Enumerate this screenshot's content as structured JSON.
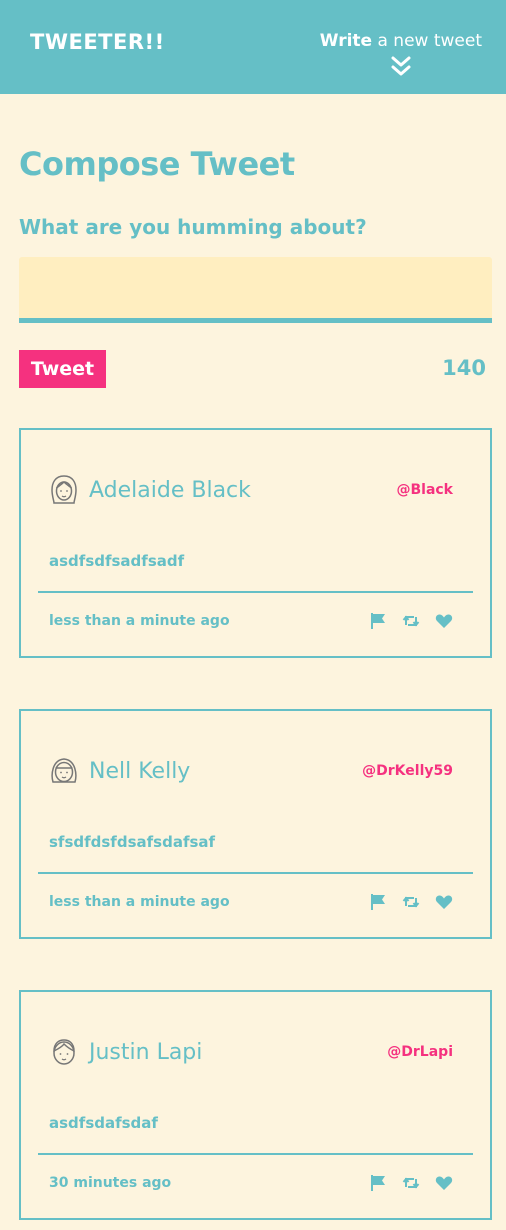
{
  "header": {
    "brand": "TWEETER!!",
    "write_bold": "Write",
    "write_rest": "a new tweet"
  },
  "compose": {
    "title": "Compose Tweet",
    "prompt": "What are you humming about?",
    "input_value": "",
    "button_label": "Tweet",
    "counter": "140"
  },
  "tweets": [
    {
      "name": "Adelaide Black",
      "handle": "@Black",
      "content": "asdfsdfsadfsadf",
      "time": "less than a minute ago",
      "avatar_icon": "woman-avatar-icon"
    },
    {
      "name": "Nell Kelly",
      "handle": "@DrKelly59",
      "content": "sfsdfdsfdsafsdafsaf",
      "time": "less than a minute ago",
      "avatar_icon": "girl-avatar-icon"
    },
    {
      "name": "Justin Lapi",
      "handle": "@DrLapi",
      "content": "asdfsdafsdaf",
      "time": "30 minutes ago",
      "avatar_icon": "man-avatar-icon"
    }
  ],
  "colors": {
    "background": "#fdf4de",
    "accent": "#65bfc6",
    "pink": "#f5317f",
    "input_bg": "#ffeec0"
  }
}
